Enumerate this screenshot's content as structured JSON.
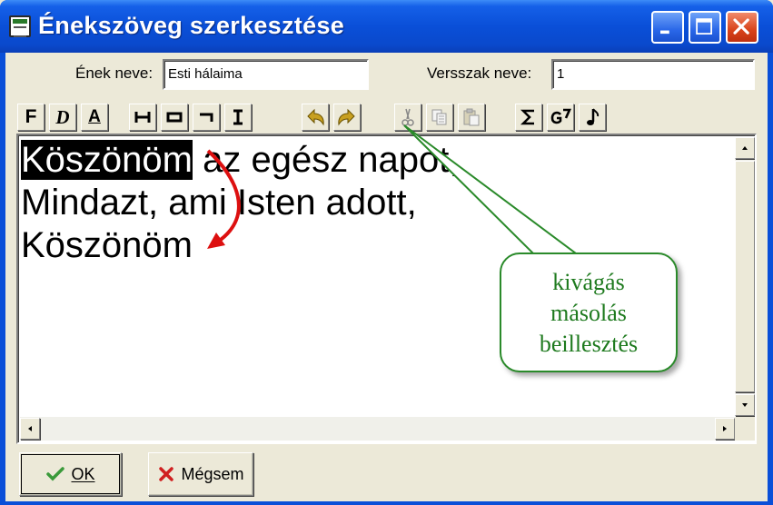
{
  "window": {
    "title": "Énekszöveg szerkesztése",
    "icons": [
      "app-icon",
      "minimize-icon",
      "maximize-icon",
      "close-icon"
    ]
  },
  "fields": {
    "song_name_label": "Ének neve:",
    "song_name_value": "Esti hálaima",
    "verse_name_label": "Versszak neve:",
    "verse_name_value": "1"
  },
  "toolbar": {
    "bold_label": "F",
    "italic_label": "D",
    "underline_label": "A",
    "buttons": [
      "bold-icon",
      "italic-icon",
      "underline-icon",
      "chord-span-icon",
      "box-icon",
      "corner-icon",
      "text-cursor-icon",
      "undo-icon",
      "redo-icon",
      "cut-icon",
      "copy-icon",
      "paste-icon",
      "sum-icon",
      "chord-icon",
      "note-icon"
    ]
  },
  "editor": {
    "lines": [
      {
        "selected": "Köszönöm",
        "rest": " az egész napot,"
      },
      {
        "text": "Mindazt, ami Isten adott,"
      },
      {
        "text": "Köszönöm"
      }
    ]
  },
  "callout": {
    "lines": [
      "kivágás",
      "másolás",
      "beillesztés"
    ],
    "color": "#1e7a1e"
  },
  "buttons": {
    "ok": "OK",
    "cancel": "Mégsem"
  },
  "colors": {
    "title_bar": "#0a4fd8",
    "arrow": "#e01010",
    "selection": "#000000"
  }
}
